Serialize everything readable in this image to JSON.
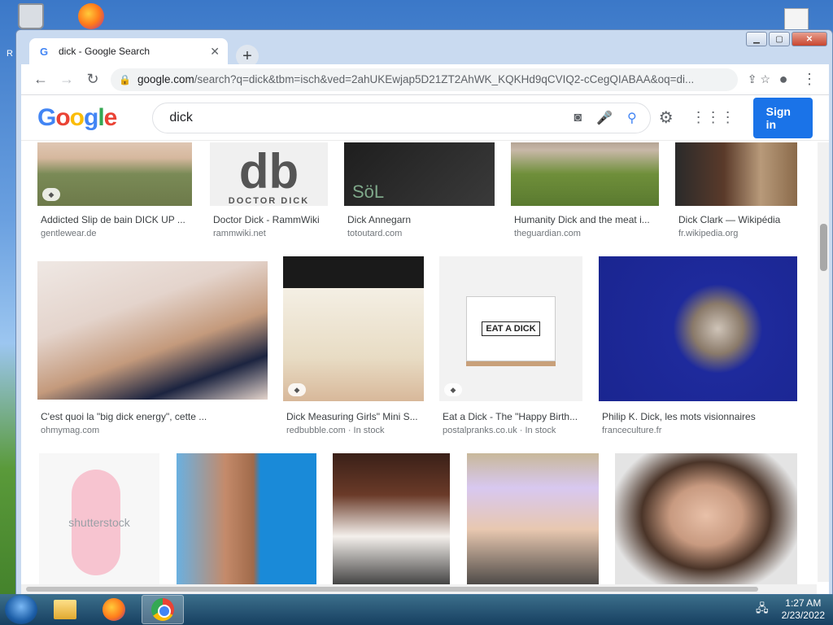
{
  "desktop": {
    "recycle_label": "R"
  },
  "window": {
    "min_glyph": "▁",
    "max_glyph": "▢",
    "close_glyph": "✕"
  },
  "tab": {
    "favicon": "G",
    "title": "dick - Google Search",
    "close": "✕",
    "new_tab": "+"
  },
  "toolbar": {
    "back": "←",
    "forward": "→",
    "reload": "↻",
    "url_host": "google.com",
    "url_path": "/search?q=dick&tbm=isch&ved=2ahUKEwjap5D21ZT2AhWK_KQKHd9qCVIQ2-cCegQIABAA&oq=di...",
    "share_icon": "⇪",
    "star_icon": "☆",
    "profile_icon": "●",
    "menu_icon": "⋮"
  },
  "search": {
    "logo": [
      "G",
      "o",
      "o",
      "g",
      "l",
      "e"
    ],
    "query": "dick",
    "camera_icon": "◙",
    "mic_icon": "🎤",
    "search_icon": "⚲",
    "settings_icon": "⚙",
    "apps_icon": "⋮⋮⋮",
    "signin_label": "Sign in"
  },
  "results": [
    {
      "caption": "Addicted Slip de bain DICK UP ...",
      "source": "gentlewear.de",
      "tag": true
    },
    {
      "caption": "Doctor Dick - RammWiki",
      "source": "rammwiki.net",
      "img_text": "db",
      "img_sub": "DOCTOR DICK"
    },
    {
      "caption": "Dick Annegarn",
      "source": "totoutard.com",
      "img_text": "SöL"
    },
    {
      "caption": "Humanity Dick and the meat i...",
      "source": "theguardian.com"
    },
    {
      "caption": "Dick Clark — Wikipédia",
      "source": "fr.wikipedia.org"
    },
    {
      "caption": "C'est quoi la \"big dick energy\", cette ...",
      "source": "ohmymag.com"
    },
    {
      "caption": "Dick Measuring Girls\" Mini S...",
      "source": "redbubble.com · In stock",
      "tag": true
    },
    {
      "caption": "Eat a Dick - The \"Happy Birth...",
      "source": "postalpranks.co.uk · In stock",
      "tag": true,
      "img_text": "EAT A DICK"
    },
    {
      "caption": "Philip K. Dick, les mots visionnaires",
      "source": "franceculture.fr"
    },
    {
      "caption": "",
      "source": "",
      "img_text": "shutterstock"
    },
    {
      "caption": "",
      "source": ""
    },
    {
      "caption": "",
      "source": ""
    },
    {
      "caption": "",
      "source": ""
    },
    {
      "caption": "",
      "source": ""
    }
  ],
  "taskbar": {
    "time": "1:27 AM",
    "date": "2/23/2022",
    "network_icon": "🖧"
  },
  "colors": {
    "accent": "#1a73e8",
    "omnibox_bg": "#f1f3f4",
    "caption_text": "#3c4043",
    "source_text": "#70757a"
  }
}
